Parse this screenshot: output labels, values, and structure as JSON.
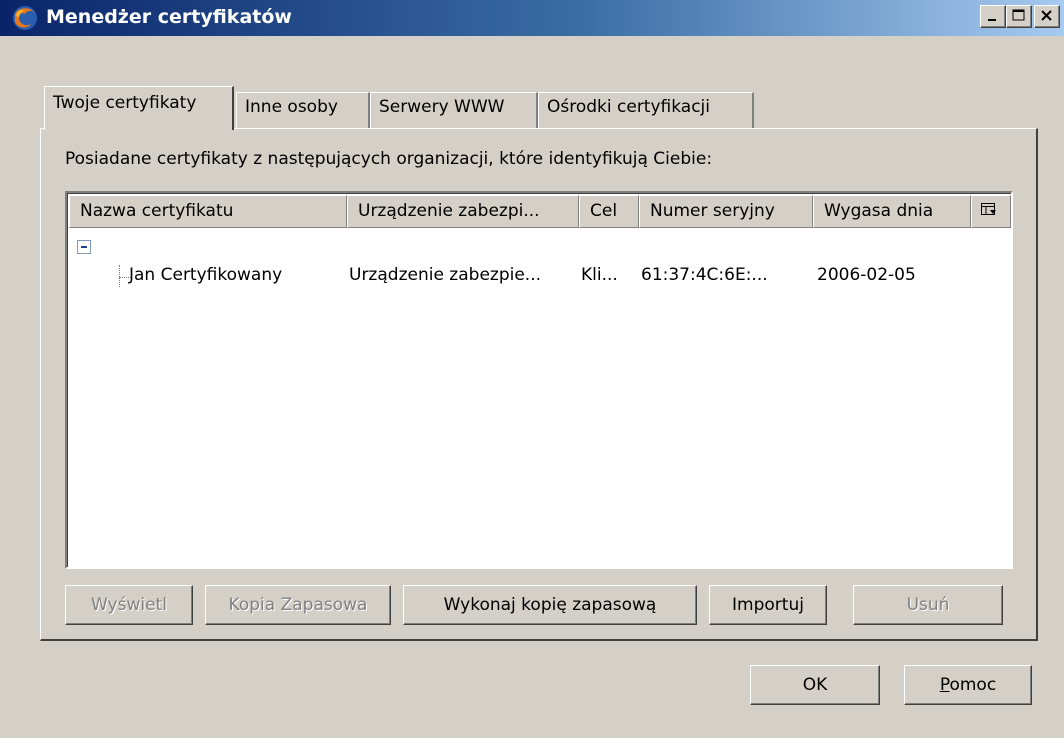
{
  "window": {
    "title": "Menedżer certyfikatów"
  },
  "tabs": [
    {
      "label": "Twoje certyfikaty",
      "active": true
    },
    {
      "label": "Inne osoby",
      "active": false
    },
    {
      "label": "Serwery WWW",
      "active": false
    },
    {
      "label": "Ośrodki certyfikacji",
      "active": false
    }
  ],
  "panel": {
    "intro": "Posiadane certyfikaty z następujących organizacji, które identyfikują Ciebie:"
  },
  "tree": {
    "columns": [
      "Nazwa certyfikatu",
      "Urządzenie zabezpi...",
      "Cel",
      "Numer seryjny",
      "Wygasa dnia"
    ],
    "rows": [
      {
        "name": "Jan Certyfikowany",
        "device": "Urządzenie zabezpie...",
        "purpose": "Kli...",
        "serial": "61:37:4C:6E:...",
        "expires": "2006-02-05"
      }
    ]
  },
  "buttons": {
    "view": "Wyświetl",
    "backup": "Kopia Zapasowa",
    "backup_all": "Wykonaj kopię zapasową",
    "import": "Importuj",
    "delete": "Usuń",
    "ok": "OK",
    "help_first": "P",
    "help_rest": "omoc"
  },
  "icons": {
    "app": "firefox-icon",
    "minimize": "minimize-icon",
    "maximize": "maximize-icon",
    "close": "close-icon",
    "column_picker": "column-picker-icon",
    "twisty": "collapse-icon"
  },
  "colors": {
    "titlebar_start": "#0a246a",
    "titlebar_end": "#a6caf0",
    "face": "#d4d0c8"
  }
}
